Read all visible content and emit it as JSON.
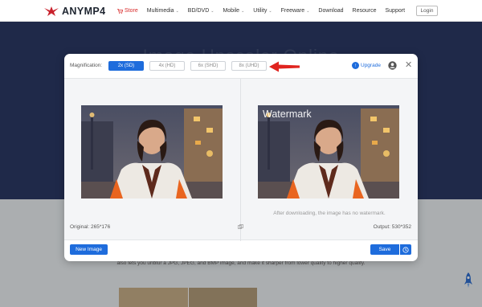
{
  "header": {
    "brand": "ANYMP4",
    "nav": [
      {
        "label": "Store",
        "icon": "cart-icon",
        "has_dropdown": false,
        "active": true
      },
      {
        "label": "Multimedia",
        "has_dropdown": true
      },
      {
        "label": "BD/DVD",
        "has_dropdown": true
      },
      {
        "label": "Mobile",
        "has_dropdown": true
      },
      {
        "label": "Utility",
        "has_dropdown": true
      },
      {
        "label": "Freeware",
        "has_dropdown": true
      },
      {
        "label": "Download",
        "has_dropdown": false
      },
      {
        "label": "Resource",
        "has_dropdown": false
      },
      {
        "label": "Support",
        "has_dropdown": false
      }
    ],
    "login_label": "Login"
  },
  "background": {
    "hero_title": "Image Upscaler Online",
    "body_text": "also lets you unblur a JPG, JPEG, and BMP image, and make it sharper from lower quality to higher quality."
  },
  "modal": {
    "magnification_label": "Magnification:",
    "magnification_options": [
      {
        "label": "2x (SD)",
        "selected": true
      },
      {
        "label": "4x (HD)",
        "selected": false
      },
      {
        "label": "6x (SHD)",
        "selected": false
      },
      {
        "label": "8x (UHD)",
        "selected": false
      }
    ],
    "upgrade_label": "Upgrade",
    "watermark_text": "Watermark",
    "no_watermark_note": "After downloading, the image has no watermark.",
    "original_size": "Original: 265*176",
    "output_size": "Output: 530*352",
    "new_image_label": "New Image",
    "save_label": "Save"
  },
  "colors": {
    "accent": "#1e6cdc",
    "brand_red": "#d82b2b",
    "hero_bg": "#2b3a66"
  }
}
